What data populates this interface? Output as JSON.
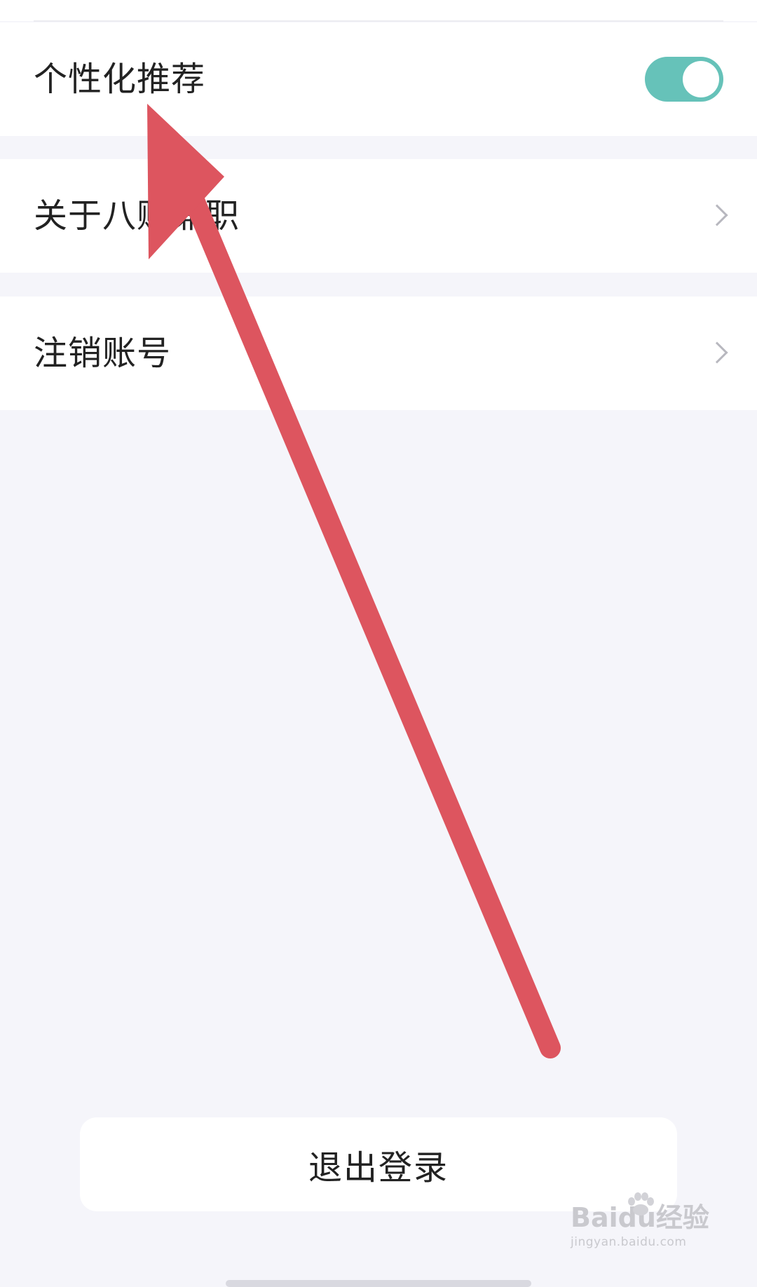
{
  "settings": {
    "personalized_recommendation": {
      "label": "个性化推荐",
      "enabled": true
    },
    "about": {
      "label": "关于八赚兼职"
    },
    "cancel_account": {
      "label": "注销账号"
    }
  },
  "logout": {
    "label": "退出登录"
  },
  "watermark": {
    "logo_text": "Baidu经验",
    "url": "jingyan.baidu.com"
  },
  "colors": {
    "toggle_on": "#66c2b9",
    "annotation_arrow": "#dd555f",
    "background": "#f5f5fa"
  },
  "icons": {
    "row_arrow": "chevron-right-icon",
    "annotation": "arrow-up-left-icon"
  }
}
